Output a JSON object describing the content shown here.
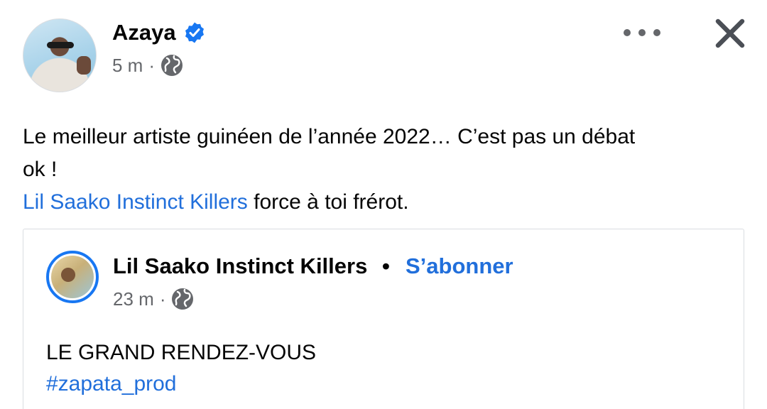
{
  "post": {
    "author": "Azaya",
    "verified": true,
    "time": "5 m",
    "separator": "·",
    "audience_icon": "globe-icon",
    "text_line1": "Le meilleur artiste guinéen de l’année 2022… C’est pas un débat",
    "text_line2": "ok !",
    "mention": "Lil Saako Instinct Killers",
    "text_line3_rest": " force à toi frérot."
  },
  "actions": {
    "more_icon": "more-dots-icon",
    "close_icon": "close-icon"
  },
  "shared_post": {
    "author": "Lil Saako Instinct Killers",
    "bullet": "•",
    "follow_label": "S’abonner",
    "time": "23 m",
    "separator": "·",
    "audience_icon": "globe-icon",
    "text": "LE GRAND RENDEZ-VOUS",
    "hashtag": "#zapata_prod"
  },
  "colors": {
    "link": "#216fdb",
    "verified": "#1877f2",
    "secondary_text": "#65676b",
    "border": "#dadde1"
  }
}
